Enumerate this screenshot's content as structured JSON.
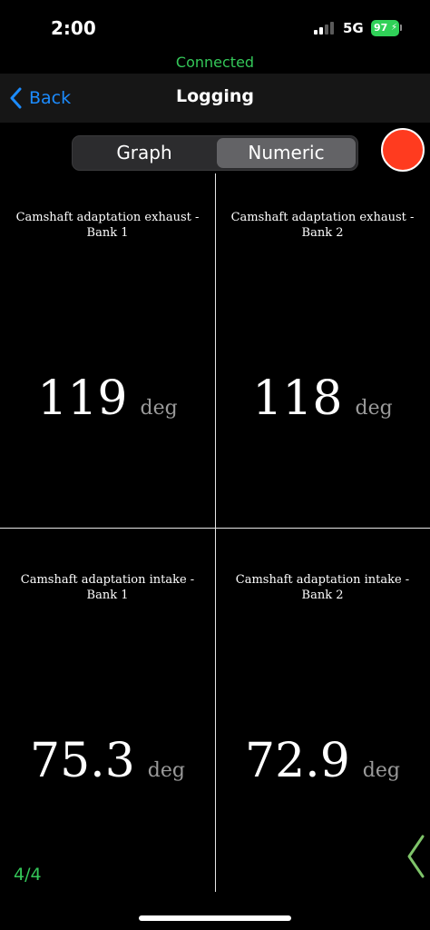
{
  "status_bar": {
    "time": "2:00",
    "network": "5G",
    "battery": "97"
  },
  "connection_status": "Connected",
  "nav": {
    "back_label": "Back",
    "title": "Logging"
  },
  "view_toggle": {
    "options": [
      "Graph",
      "Numeric"
    ],
    "selected": "Numeric"
  },
  "readings": [
    {
      "label": "Camshaft adaptation exhaust  - Bank 1",
      "value": "119",
      "unit": "deg"
    },
    {
      "label": "Camshaft adaptation exhaust  - Bank 2",
      "value": "118",
      "unit": "deg"
    },
    {
      "label": "Camshaft adaptation intake  - Bank 1",
      "value": "75.3",
      "unit": "deg"
    },
    {
      "label": "Camshaft adaptation intake  - Bank 2",
      "value": "72.9",
      "unit": "deg"
    }
  ],
  "page_indicator": "4/4",
  "colors": {
    "accent": "#1c8cff",
    "connected": "#34c759",
    "record": "#ff3b1f",
    "battery": "#30d158"
  },
  "icons": {
    "back": "chevron-left-icon",
    "pager": "chevron-left-icon",
    "record": "record-circle-icon"
  }
}
